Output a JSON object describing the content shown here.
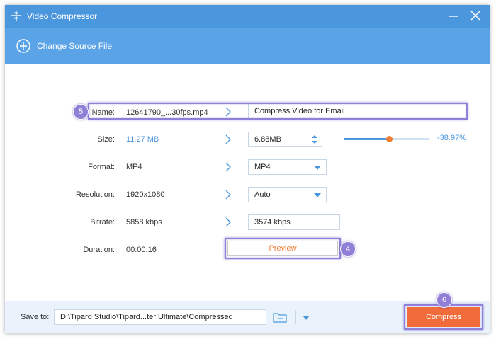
{
  "titlebar": {
    "title": "Video Compressor",
    "icon": "compress-icon",
    "minimize_icon": "minimize-icon",
    "close_icon": "close-icon"
  },
  "toolbar": {
    "change_source_label": "Change Source File",
    "change_source_icon": "plus-circle-icon"
  },
  "form": {
    "name": {
      "label": "Name:",
      "source": "12641790_...30fps.mp4",
      "target": "Compress Video for Email"
    },
    "size": {
      "label": "Size:",
      "source": "11.27 MB",
      "target": "6.88MB",
      "reduction": "-38.97%",
      "slider_fraction": 0.53
    },
    "format": {
      "label": "Format:",
      "source": "MP4",
      "target": "MP4"
    },
    "resolution": {
      "label": "Resolution:",
      "source": "1920x1080",
      "target": "Auto"
    },
    "bitrate": {
      "label": "Bitrate:",
      "source": "5858 kbps",
      "target": "3574 kbps"
    },
    "duration": {
      "label": "Duration:",
      "source": "00:00:16",
      "preview_label": "Preview"
    }
  },
  "footer": {
    "save_to_label": "Save to:",
    "save_path": "D:\\Tipard Studio\\Tipard...ter Ultimate\\Compressed",
    "compress_label": "Compress"
  },
  "annotations": {
    "badge_name": "5",
    "badge_preview": "4",
    "badge_compress": "6"
  },
  "colors": {
    "titlebar": "#4a97dd",
    "toolbar": "#5aa3e6",
    "accent_orange": "#f07d30",
    "compress_button": "#f26b3a",
    "highlight": "#8f7fd6"
  }
}
